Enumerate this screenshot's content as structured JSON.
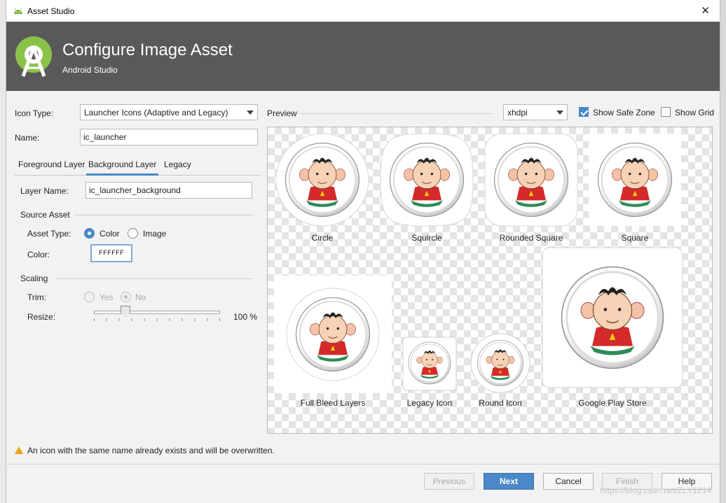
{
  "window": {
    "title": "Asset Studio",
    "close_label": "✕"
  },
  "banner": {
    "heading": "Configure Image Asset",
    "subheading": "Android Studio"
  },
  "form": {
    "icon_type_label": "Icon Type:",
    "icon_type_value": "Launcher Icons (Adaptive and Legacy)",
    "name_label": "Name:",
    "name_value": "ic_launcher"
  },
  "tabs": [
    {
      "label": "Foreground Layer",
      "active": false
    },
    {
      "label": "Background Layer",
      "active": true
    },
    {
      "label": "Legacy",
      "active": false
    }
  ],
  "layer": {
    "layer_name_label": "Layer Name:",
    "layer_name_value": "ic_launcher_background",
    "source_asset_title": "Source Asset",
    "asset_type_label": "Asset Type:",
    "asset_type_options": [
      "Color",
      "Image"
    ],
    "asset_type_selected": "Color",
    "color_label": "Color:",
    "color_value": "FFFFFF",
    "scaling_title": "Scaling",
    "trim_label": "Trim:",
    "trim_options": [
      "Yes",
      "No"
    ],
    "trim_selected": "No",
    "resize_label": "Resize:",
    "resize_value": "100 %",
    "resize_percent": 100
  },
  "preview": {
    "label": "Preview",
    "density": "xhdpi",
    "show_safe_zone_label": "Show Safe Zone",
    "show_safe_zone_checked": true,
    "show_grid_label": "Show Grid",
    "show_grid_checked": false,
    "items": [
      "Circle",
      "Squircle",
      "Rounded Square",
      "Square",
      "Full Bleed Layers",
      "Legacy Icon",
      "Round Icon",
      "Google Play Store"
    ]
  },
  "warning": "An icon with the same name already exists and will be overwritten.",
  "buttons": {
    "previous": "Previous",
    "next": "Next",
    "cancel": "Cancel",
    "finish": "Finish",
    "help": "Help"
  },
  "watermark": "https://blog.csdn.net/ZLY1214",
  "colors": {
    "accent": "#4a88c7",
    "banner": "#595959",
    "warning": "#e8a317",
    "android_green": "#7cb342"
  }
}
